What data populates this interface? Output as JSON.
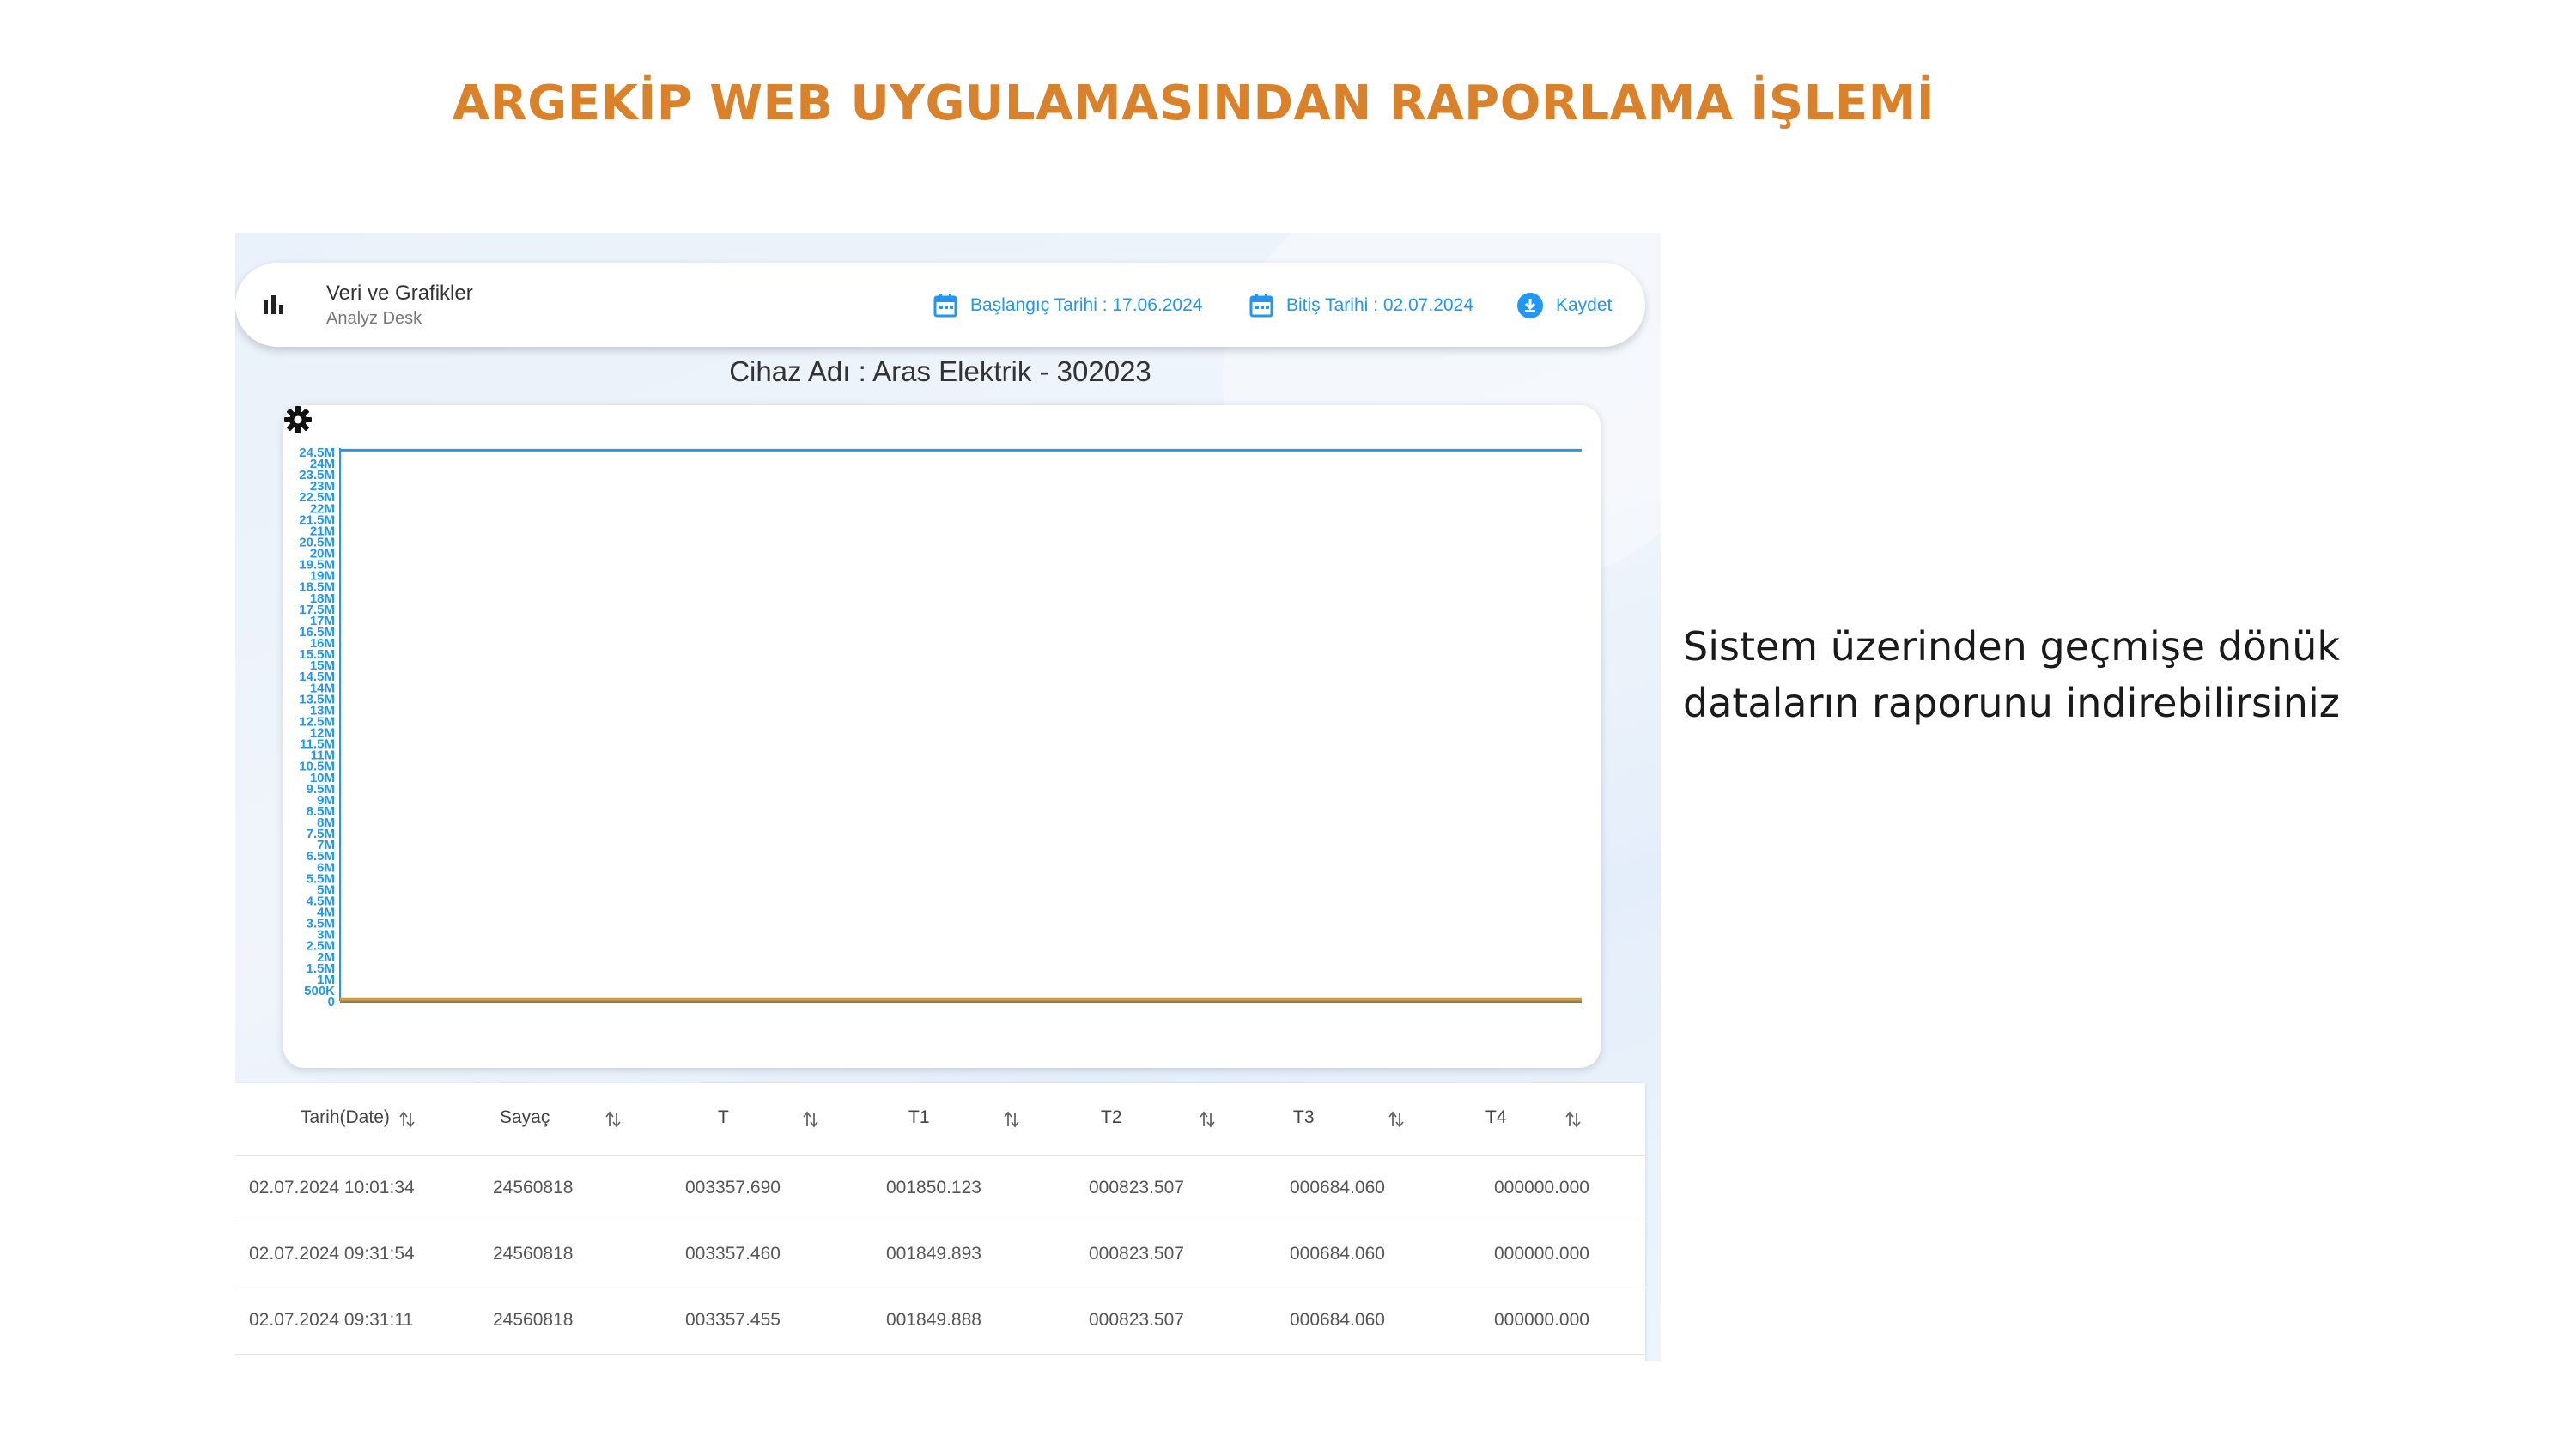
{
  "page": {
    "headline": "ARGEKİP WEB UYGULAMASINDAN RAPORLAMA İŞLEMİ",
    "description_lines": [
      "Sistem üzerinden geçmişe dönük",
      "dataların raporunu indirebilirsiniz"
    ]
  },
  "app": {
    "icon": "bar-chart-icon",
    "title": "Veri ve Grafikler",
    "subtitle": "Analyz Desk",
    "start_date_label": "Başlangıç Tarihi : 17.06.2024",
    "end_date_label": "Bitiş Tarihi : 02.07.2024",
    "save_label": "Kaydet",
    "accent_color": "#2196f3"
  },
  "device_title": "Cihaz Adı : Aras Elektrik - 302023",
  "chart_data": {
    "type": "line",
    "title": "",
    "xlabel": "",
    "ylabel": "",
    "ylim": [
      0,
      24500000
    ],
    "y_ticks": [
      "0",
      "500K",
      "1M",
      "1.5M",
      "2M",
      "2.5M",
      "3M",
      "3.5M",
      "4M",
      "4.5M",
      "5M",
      "5.5M",
      "6M",
      "6.5M",
      "7M",
      "7.5M",
      "8M",
      "8.5M",
      "9M",
      "9.5M",
      "10M",
      "10.5M",
      "11M",
      "11.5M",
      "12M",
      "12.5M",
      "13M",
      "13.5M",
      "14M",
      "14.5M",
      "15M",
      "15.5M",
      "16M",
      "16.5M",
      "17M",
      "17.5M",
      "18M",
      "18.5M",
      "19M",
      "19.5M",
      "20M",
      "20.5M",
      "21M",
      "21.5M",
      "22M",
      "22.5M",
      "23M",
      "23.5M",
      "24M",
      "24.5M"
    ],
    "grid": false,
    "series": [
      {
        "color": "#2196f3",
        "values": [
          24560818,
          24560818
        ]
      },
      {
        "color": "#c8a415",
        "values": [
          3357.69,
          3357.455
        ]
      },
      {
        "color": "#e59b2b",
        "values": [
          1850.123,
          1849.888
        ]
      },
      {
        "color": "#7cb342",
        "values": [
          823.507,
          823.507
        ]
      },
      {
        "color": "#8d6e63",
        "values": [
          684.06,
          684.06
        ]
      }
    ]
  },
  "table": {
    "columns": [
      "Tarih(Date)",
      "Sayaç",
      "T",
      "T1",
      "T2",
      "T3",
      "T4"
    ],
    "rows": [
      [
        "02.07.2024 10:01:34",
        "24560818",
        "003357.690",
        "001850.123",
        "000823.507",
        "000684.060",
        "000000.000"
      ],
      [
        "02.07.2024 09:31:54",
        "24560818",
        "003357.460",
        "001849.893",
        "000823.507",
        "000684.060",
        "000000.000"
      ],
      [
        "02.07.2024 09:31:11",
        "24560818",
        "003357.455",
        "001849.888",
        "000823.507",
        "000684.060",
        "000000.000"
      ]
    ]
  }
}
